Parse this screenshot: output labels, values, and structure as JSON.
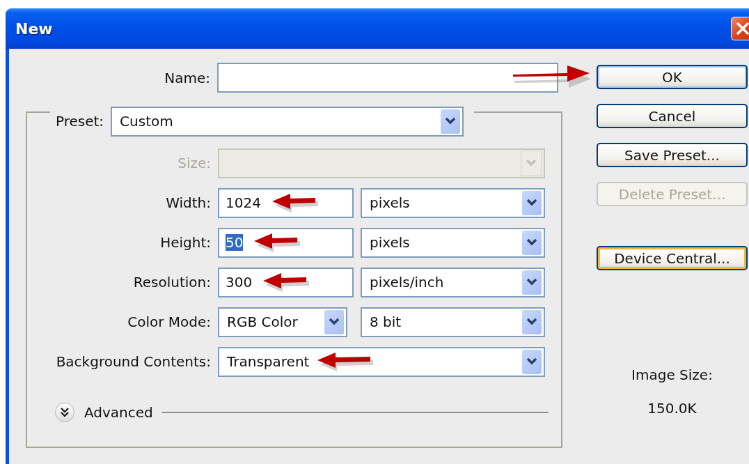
{
  "window": {
    "title": "New"
  },
  "name_field": {
    "label": "Name:",
    "annotated": true
  },
  "preset": {
    "label": "Preset:",
    "value": "Custom"
  },
  "rows": [
    {
      "kind": "select",
      "label": "Size:",
      "disabled": true,
      "annotated": false
    },
    {
      "kind": "number",
      "label": "Width:",
      "value": "1024",
      "text_selected": false,
      "annotated": true,
      "unit": "pixels",
      "disabled": false
    },
    {
      "kind": "number",
      "label": "Height:",
      "value": "50",
      "text_selected": true,
      "annotated": true,
      "unit": "pixels",
      "disabled": false
    },
    {
      "kind": "number",
      "label": "Resolution:",
      "value": "300",
      "text_selected": false,
      "annotated": true,
      "unit": "pixels/inch",
      "disabled": false
    },
    {
      "kind": "pair",
      "label": "Color Mode:",
      "value": "RGB Color",
      "unit": "8 bit",
      "annotated": false,
      "disabled": false
    },
    {
      "kind": "select",
      "label": "Background Contents:",
      "value": "Transparent",
      "annotated": true,
      "disabled": false
    }
  ],
  "advanced": {
    "label": "Advanced",
    "expanded": false
  },
  "buttons": [
    {
      "label": "OK",
      "default": true,
      "focused": false,
      "disabled": false
    },
    {
      "label": "Cancel",
      "default": false,
      "focused": false,
      "disabled": false
    },
    {
      "label": "Save Preset...",
      "default": false,
      "focused": false,
      "disabled": false
    },
    {
      "label": "Delete Preset...",
      "default": false,
      "focused": false,
      "disabled": true
    },
    {
      "label": "Device Central...",
      "default": false,
      "focused": true,
      "disabled": false
    }
  ],
  "image_size": {
    "label": "Image Size:",
    "value": "150.0K"
  }
}
